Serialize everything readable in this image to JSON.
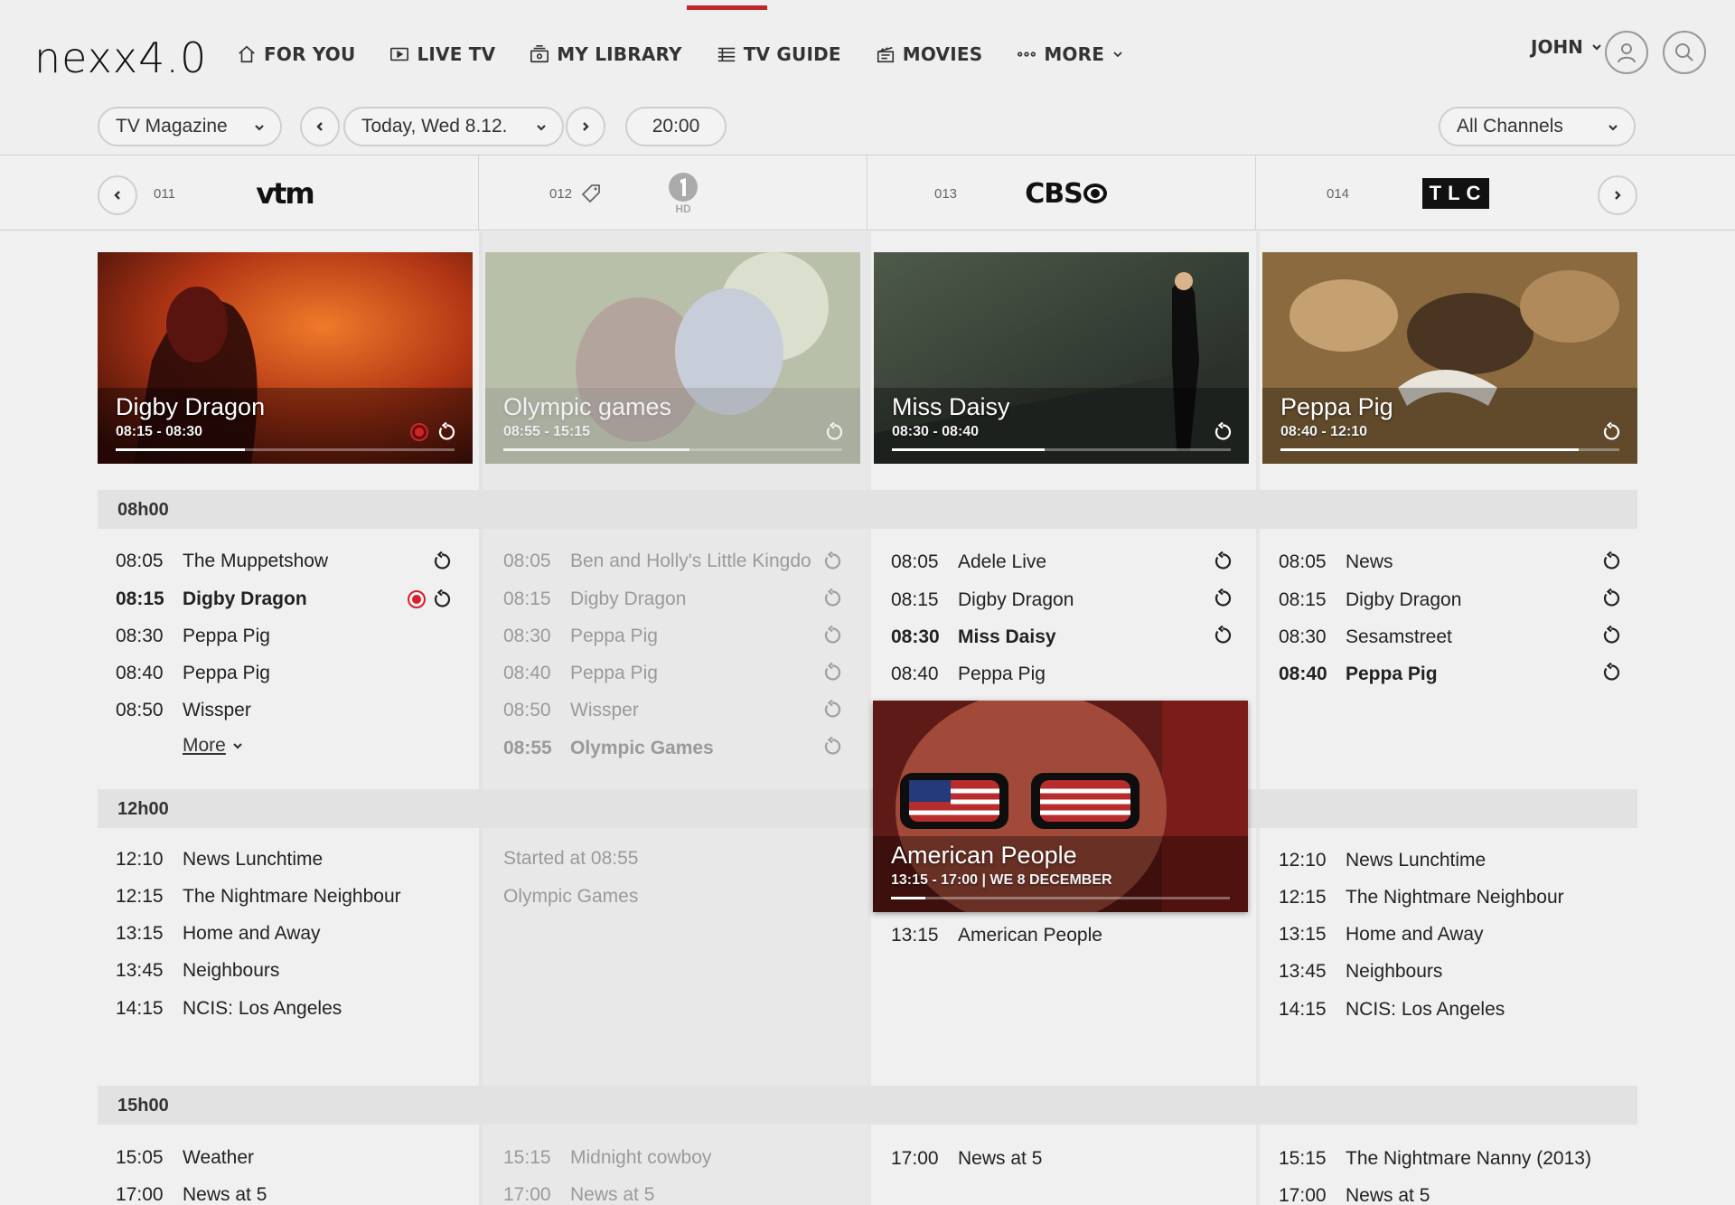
{
  "app": {
    "logo": "nexx4.0"
  },
  "nav": {
    "items": [
      {
        "label": "FOR YOU",
        "icon": "home-icon"
      },
      {
        "label": "LIVE TV",
        "icon": "play-tv-icon"
      },
      {
        "label": "MY LIBRARY",
        "icon": "library-icon"
      },
      {
        "label": "TV GUIDE",
        "icon": "guide-icon",
        "active": true
      },
      {
        "label": "MOVIES",
        "icon": "clapper-icon"
      },
      {
        "label": "MORE",
        "icon": "dots-icon"
      }
    ],
    "user": "JOHN",
    "accent_color": "#c0272d"
  },
  "filters": {
    "view": "TV Magazine",
    "date": "Today, Wed 8.12.",
    "time": "20:00",
    "channels": "All Channels"
  },
  "channels": [
    {
      "number": "011",
      "name": "vtm"
    },
    {
      "number": "012",
      "name": "HD"
    },
    {
      "number": "013",
      "name": "CBS"
    },
    {
      "number": "014",
      "name": "TLC"
    }
  ],
  "heroes": [
    {
      "title": "Digby Dragon",
      "time": "08:15 - 08:30",
      "progress": 0.38,
      "recording": true
    },
    {
      "title": "Olympic games",
      "time": "08:55 - 15:15",
      "progress": 0.55,
      "recording": false
    },
    {
      "title": "Miss Daisy",
      "time": "08:30 - 08:40",
      "progress": 0.45,
      "recording": false
    },
    {
      "title": "Peppa Pig",
      "time": "08:40 - 12:10",
      "progress": 0.88,
      "recording": false
    }
  ],
  "bands": {
    "b1": "08h00",
    "b2": "12h00",
    "b3": "15h00"
  },
  "schedule": {
    "c1": {
      "morning": [
        {
          "time": "08:05",
          "title": "The Muppetshow"
        },
        {
          "time": "08:15",
          "title": "Digby Dragon"
        },
        {
          "time": "08:30",
          "title": "Peppa Pig"
        },
        {
          "time": "08:40",
          "title": "Peppa Pig"
        },
        {
          "time": "08:50",
          "title": "Wissper"
        }
      ],
      "more": "More",
      "noon": [
        {
          "time": "12:10",
          "title": "News Lunchtime"
        },
        {
          "time": "12:15",
          "title": "The Nightmare Neighbour"
        },
        {
          "time": "13:15",
          "title": "Home and Away"
        },
        {
          "time": "13:45",
          "title": "Neighbours"
        },
        {
          "time": "14:15",
          "title": "NCIS: Los Angeles"
        }
      ],
      "afternoon": [
        {
          "time": "15:05",
          "title": "Weather"
        },
        {
          "time": "17:00",
          "title": "News at 5"
        }
      ]
    },
    "c2": {
      "morning": [
        {
          "time": "08:05",
          "title": "Ben and Holly's Little Kingdo"
        },
        {
          "time": "08:15",
          "title": "Digby Dragon"
        },
        {
          "time": "08:30",
          "title": "Peppa Pig"
        },
        {
          "time": "08:40",
          "title": "Peppa Pig"
        },
        {
          "time": "08:50",
          "title": "Wissper"
        },
        {
          "time": "08:55",
          "title": "Olympic Games"
        }
      ],
      "noon_started": "Started at 08:55",
      "noon_title": "Olympic Games",
      "afternoon": [
        {
          "time": "15:15",
          "title": "Midnight cowboy"
        },
        {
          "time": "17:00",
          "title": "News at 5"
        }
      ]
    },
    "c3": {
      "morning": [
        {
          "time": "08:05",
          "title": "Adele Live"
        },
        {
          "time": "08:15",
          "title": "Digby Dragon"
        },
        {
          "time": "08:30",
          "title": "Miss Daisy"
        },
        {
          "time": "08:40",
          "title": "Peppa Pig"
        }
      ],
      "feature": {
        "title": "American People",
        "time": "13:15 - 17:00 | WE 8 DECEMBER",
        "progress": 0.1
      },
      "noon": [
        {
          "time": "13:15",
          "title": "American People"
        }
      ],
      "afternoon": [
        {
          "time": "17:00",
          "title": "News at 5"
        }
      ]
    },
    "c4": {
      "morning": [
        {
          "time": "08:05",
          "title": "News"
        },
        {
          "time": "08:15",
          "title": "Digby Dragon"
        },
        {
          "time": "08:30",
          "title": "Sesamstreet"
        },
        {
          "time": "08:40",
          "title": "Peppa Pig"
        }
      ],
      "noon": [
        {
          "time": "12:10",
          "title": "News Lunchtime"
        },
        {
          "time": "12:15",
          "title": "The Nightmare Neighbour"
        },
        {
          "time": "13:15",
          "title": "Home and Away"
        },
        {
          "time": "13:45",
          "title": "Neighbours"
        },
        {
          "time": "14:15",
          "title": "NCIS: Los Angeles"
        }
      ],
      "afternoon": [
        {
          "time": "15:15",
          "title": "The Nightmare Nanny (2013)"
        },
        {
          "time": "17:00",
          "title": "News at 5"
        }
      ]
    }
  }
}
